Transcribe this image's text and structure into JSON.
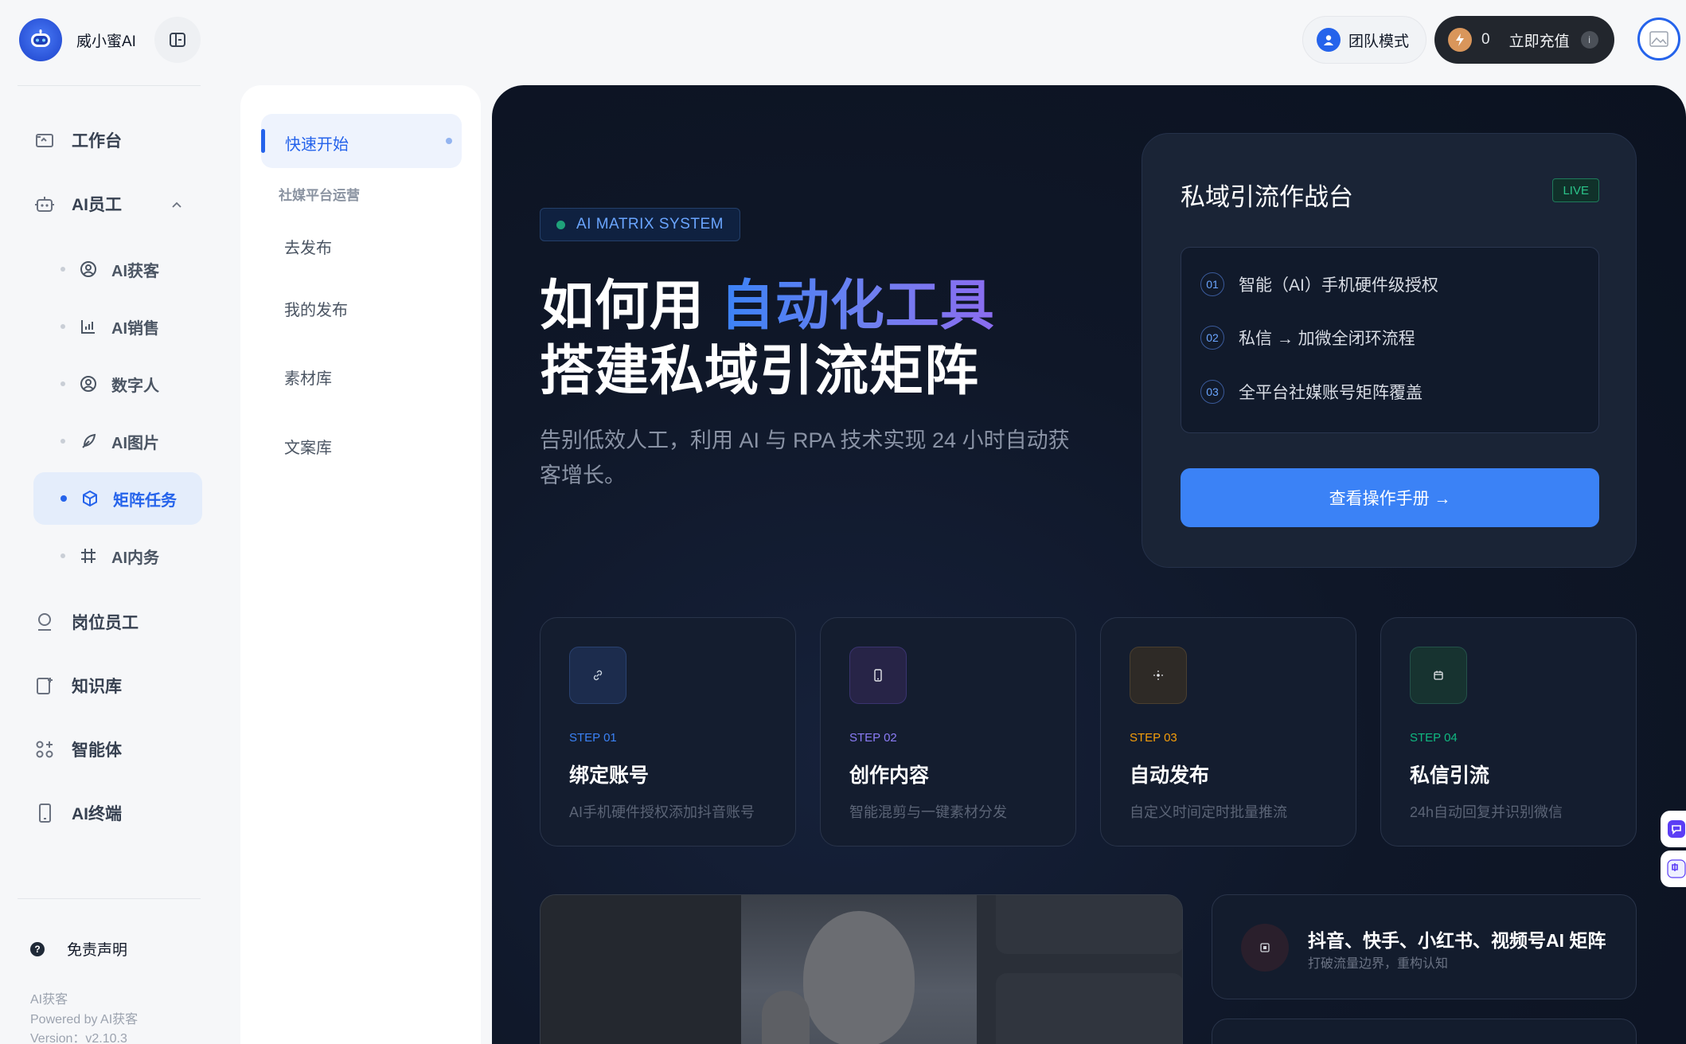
{
  "brand": {
    "name": "威小蜜AI",
    "logo_icon": "robot-icon",
    "collapse_icon": "sidebar-toggle-icon"
  },
  "nav": {
    "workbench": "工作台",
    "ai_staff": "AI员工",
    "sub": [
      "AI获客",
      "AI销售",
      "数字人",
      "AI图片",
      "矩阵任务",
      "AI内务"
    ],
    "post_staff": "岗位员工",
    "knowledge": "知识库",
    "agent": "智能体",
    "terminal": "AI终端"
  },
  "footer": {
    "disclaimer": "免责声明",
    "app": "AI获客",
    "powered": "Powered by AI获客",
    "version": "Version：v2.10.3"
  },
  "submenu": {
    "active": "快速开始",
    "group": "社媒平台运营",
    "items": [
      "去发布",
      "我的发布",
      "素材库",
      "文案库"
    ]
  },
  "topbar": {
    "team_mode": "团队模式",
    "credits": "0",
    "recharge": "立即充值",
    "info": "i"
  },
  "hero": {
    "badge": "AI MATRIX SYSTEM",
    "title_prefix": "如何用 ",
    "title_highlight": "自动化工具",
    "title_line2": "搭建私域引流矩阵",
    "desc": "告别低效人工，利用 AI 与 RPA 技术实现 24 小时自动获客增长。"
  },
  "ops": {
    "title": "私域引流作战台",
    "live": "LIVE",
    "items": [
      {
        "num": "01",
        "text": "智能（AI）手机硬件级授权"
      },
      {
        "num": "02",
        "text": "私信 → 加微全闭环流程"
      },
      {
        "num": "03",
        "text": "全平台社媒账号矩阵覆盖"
      }
    ],
    "button": "查看操作手册 →"
  },
  "steps": [
    {
      "label": "STEP 01",
      "title": "绑定账号",
      "desc": "AI手机硬件授权添加抖音账号",
      "icon": "link-icon",
      "color": "#3b82f6"
    },
    {
      "label": "STEP 02",
      "title": "创作内容",
      "desc": "智能混剪与一键素材分发",
      "icon": "phone-icon",
      "color": "#8b7cf6"
    },
    {
      "label": "STEP 03",
      "title": "自动发布",
      "desc": "自定义时间定时批量推流",
      "icon": "sparkle-icon",
      "color": "#f59e0b"
    },
    {
      "label": "STEP 04",
      "title": "私信引流",
      "desc": "24h自动回复并识别微信",
      "icon": "calendar-icon",
      "color": "#10b981"
    }
  ],
  "matrix": {
    "title": "抖音、快手、小红书、视频号AI 矩阵",
    "subtitle": "打破流量边界，重构认知"
  }
}
